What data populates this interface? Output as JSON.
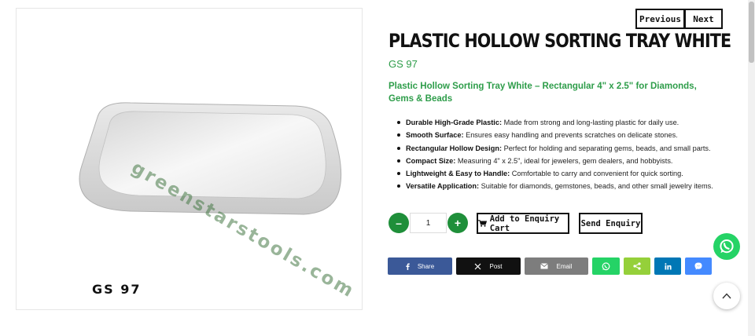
{
  "gallery": {
    "thumbnail_code": "GS 97"
  },
  "image": {
    "watermark": "greenstarstools.com",
    "code_label": "GS 97"
  },
  "nav": {
    "previous_label": "Previous",
    "next_label": "Next"
  },
  "product": {
    "title": "PLASTIC HOLLOW SORTING TRAY WHITE",
    "code": "GS 97",
    "subtitle": "Plastic Hollow Sorting Tray White – Rectangular 4\" x 2.5\" for Diamonds, Gems & Beads",
    "features": [
      {
        "label": "Durable High-Grade Plastic:",
        "text": " Made from strong and long-lasting plastic for daily use."
      },
      {
        "label": "Smooth Surface:",
        "text": " Ensures easy handling and prevents scratches on delicate stones."
      },
      {
        "label": "Rectangular Hollow Design:",
        "text": " Perfect for holding and separating gems, beads, and small parts."
      },
      {
        "label": "Compact Size:",
        "text": " Measuring 4\" x 2.5\", ideal for jewelers, gem dealers, and hobbyists."
      },
      {
        "label": "Lightweight & Easy to Handle:",
        "text": " Comfortable to carry and convenient for quick sorting."
      },
      {
        "label": "Versatile Application:",
        "text": " Suitable for diamonds, gemstones, beads, and other small jewelry items."
      }
    ]
  },
  "quantity": {
    "minus_label": "–",
    "value": "1",
    "plus_label": "+"
  },
  "actions": {
    "add_to_cart_label": "Add to Enquiry Cart",
    "send_enquiry_label": "Send Enquiry"
  },
  "share": {
    "facebook_label": "Share",
    "x_label": "Post",
    "email_label": "Email"
  },
  "colors": {
    "accent_green": "#2e9d4a",
    "button_green": "#1f8f3a",
    "facebook": "#3b5998",
    "whatsapp": "#25d366",
    "linkedin": "#0077b5",
    "messenger": "#448aff",
    "sharethis": "#95d03a",
    "email": "#7d7d7d"
  },
  "icons": [
    "cart-icon",
    "facebook-icon",
    "x-icon",
    "email-icon",
    "whatsapp-icon",
    "share-icon",
    "linkedin-icon",
    "messenger-icon",
    "chevron-up-icon"
  ]
}
